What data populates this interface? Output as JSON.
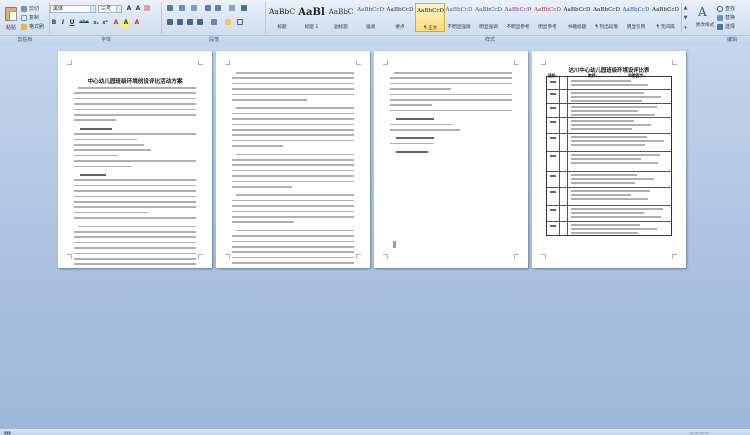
{
  "ribbon": {
    "clipboard": {
      "paste_label": "粘贴",
      "cut_label": "剪切",
      "copy_label": "复制",
      "format_painter_label": "格式刷",
      "group_label": "剪贴板"
    },
    "font": {
      "font_name": "黑体",
      "font_size": "三号",
      "group_label": "字体",
      "buttons": [
        "B",
        "I",
        "U",
        "abe",
        "x₂",
        "x²",
        "A",
        "A",
        "A"
      ]
    },
    "paragraph": {
      "group_label": "段落"
    },
    "styles": {
      "group_label": "样式",
      "items": [
        {
          "preview": "AaBbC",
          "name": "标题"
        },
        {
          "preview": "AaBl",
          "name": "标题 1"
        },
        {
          "preview": "AaBbC",
          "name": "副标题"
        },
        {
          "preview": "AaBbCcD",
          "name": "强调"
        },
        {
          "preview": "AaBbCcD",
          "name": "要点"
        },
        {
          "preview": "AaBbCcD",
          "name": "¶ 正文"
        },
        {
          "preview": "AaBbCcD",
          "name": "不明显强调"
        },
        {
          "preview": "AaBbCcD",
          "name": "明显强调"
        },
        {
          "preview": "AaBbCcD",
          "name": "不明显参考"
        },
        {
          "preview": "AaBbCcD",
          "name": "明显参考"
        },
        {
          "preview": "AaBbCcD",
          "name": "书籍标题"
        },
        {
          "preview": "AaBbCcD",
          "name": "¶ 列出段落"
        },
        {
          "preview": "AaBbCcD",
          "name": "明显引用"
        },
        {
          "preview": "AaBbCcD",
          "name": "¶ 无间隔"
        }
      ],
      "change_styles_label": "更改样式"
    },
    "editing": {
      "find_label": "查找",
      "replace_label": "替换",
      "select_label": "选择",
      "group_label": "编辑"
    }
  },
  "document": {
    "page1_title": "中心幼儿园班级环境创设评比活动方案",
    "page3_title": "达川中心幼儿园班级环境设评比表",
    "page3_header": {
      "class_label": "班级:",
      "teacher_label": "教师:",
      "judge_label": "评委签字:"
    }
  },
  "colors": {
    "accent": "#2a5aa6",
    "ribbon_bg": "#d5e2f2",
    "workspace_bg": "#a9c0de"
  }
}
